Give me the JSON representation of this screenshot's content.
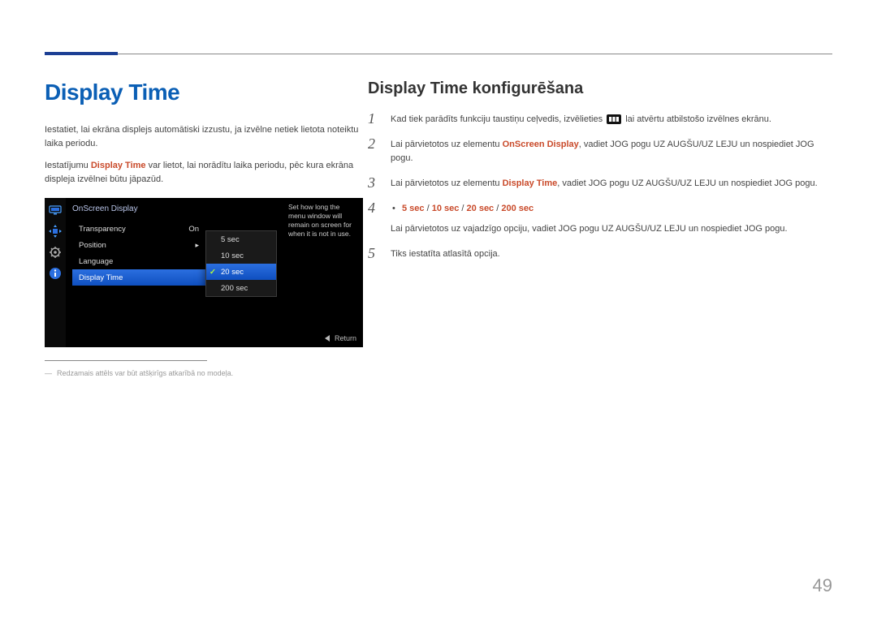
{
  "page_number": "49",
  "left": {
    "heading": "Display Time",
    "para1": "Iestatiet, lai ekrāna displejs automātiski izzustu, ja izvēlne netiek lietota noteiktu laika periodu.",
    "para2_pre": "Iestatījumu ",
    "para2_hl": "Display Time",
    "para2_post": " var lietot, lai norādītu laika periodu, pēc kura ekrāna displeja izvēlnei būtu jāpazūd.",
    "footnote": "Redzamais attēls var būt atšķirīgs atkarībā no modeļa."
  },
  "osd": {
    "title": "OnScreen Display",
    "menu": [
      {
        "label": "Transparency",
        "value": "On"
      },
      {
        "label": "Position",
        "value": "▸"
      },
      {
        "label": "Language",
        "value": ""
      },
      {
        "label": "Display Time",
        "value": ""
      }
    ],
    "active_index": 3,
    "options": [
      "5 sec",
      "10 sec",
      "20 sec",
      "200 sec"
    ],
    "selected_option_index": 2,
    "help_text": "Set how long the menu window will remain on screen for when it is not in use.",
    "footer": "Return"
  },
  "right": {
    "heading": "Display Time konfigurēšana",
    "step1_pre": "Kad tiek parādīts funkciju taustiņu ceļvedis, izvēlieties ",
    "step1_post": " lai atvērtu atbilstošo izvēlnes ekrānu.",
    "step2_pre": "Lai pārvietotos uz elementu ",
    "step2_hl": "OnScreen Display",
    "step2_post": ", vadiet JOG pogu UZ AUGŠU/UZ LEJU un nospiediet JOG pogu.",
    "step3_pre": "Lai pārvietotos uz elementu ",
    "step3_hl": "Display Time",
    "step3_post": ", vadiet JOG pogu UZ AUGŠU/UZ LEJU un nospiediet JOG pogu.",
    "options": [
      "5 sec",
      "10 sec",
      "20 sec",
      "200 sec"
    ],
    "options_sep": " / ",
    "step4": "Lai pārvietotos uz vajadzīgo opciju, vadiet JOG pogu UZ AUGŠU/UZ LEJU un nospiediet JOG pogu.",
    "step5": "Tiks iestatīta atlasītā opcija."
  }
}
